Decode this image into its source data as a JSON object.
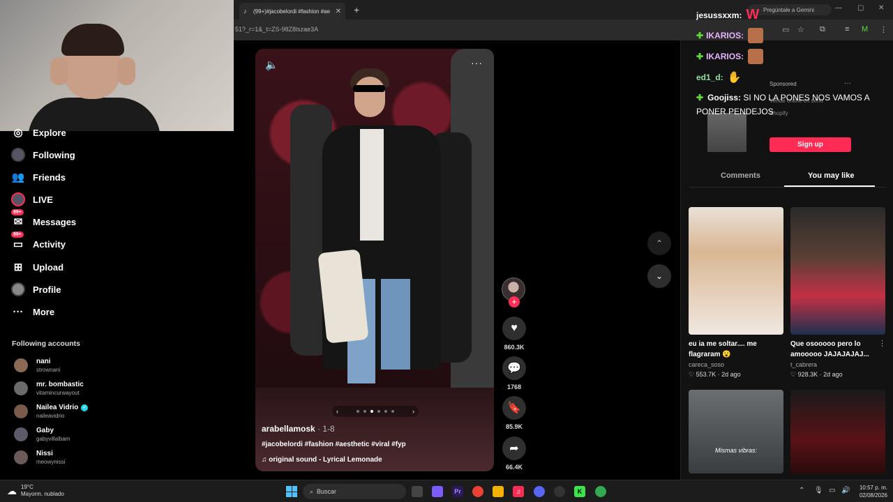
{
  "browser": {
    "tab_title": "(99+)#jacobelordi #fashion #ae",
    "url_fragment": "51?_r=1&_t=ZS-98Z8lszae3A",
    "gemini_label": "Pregúntale a Gemini"
  },
  "sidebar": {
    "nav": [
      {
        "label": "Explore",
        "icon": "explore-icon"
      },
      {
        "label": "Following",
        "icon": "following-icon"
      },
      {
        "label": "Friends",
        "icon": "friends-icon"
      },
      {
        "label": "LIVE",
        "icon": "live-icon"
      },
      {
        "label": "Messages",
        "icon": "messages-icon",
        "badge": "99+"
      },
      {
        "label": "Activity",
        "icon": "activity-icon",
        "badge": "99+"
      },
      {
        "label": "Upload",
        "icon": "upload-icon"
      },
      {
        "label": "Profile",
        "icon": "profile-icon"
      },
      {
        "label": "More",
        "icon": "more-icon"
      }
    ],
    "following_heading": "Following accounts",
    "accounts": [
      {
        "name": "nani",
        "user": "strownani",
        "color": "#8a6a55"
      },
      {
        "name": "mr. bombastic",
        "user": "vitamincurwayout",
        "color": "#6b6b6b"
      },
      {
        "name": "Nailea Vidrio",
        "user": "naileavidrio",
        "color": "#7a5a4a",
        "verified": true
      },
      {
        "name": "Gaby",
        "user": "gabyvillalbam",
        "color": "#5a5a6a"
      },
      {
        "name": "Nissi",
        "user": "meowynissi",
        "color": "#6a5a5a"
      }
    ]
  },
  "video": {
    "author": "arabellamosk",
    "date": " · 1-8",
    "tags": "#jacobelordi #fashion #aesthetic #viral #fyp",
    "sound": "original sound - Lyrical Lemonade",
    "carousel_current": 3,
    "carousel_total": 6
  },
  "actions": {
    "likes": "860.3K",
    "comments": "1768",
    "saves": "85.9K",
    "shares": "66.4K"
  },
  "ad": {
    "sponsored": "Sponsored",
    "title": "Vende online en serio",
    "brand": "Shopify",
    "cta": "Sign up"
  },
  "panel": {
    "tab_comments": "Comments",
    "tab_you_may_like": "You may like"
  },
  "cards": [
    {
      "title": "eu ia me soltar.... me flagraram 😮",
      "user": "careca_soso",
      "likes": "553.7K",
      "age": "2d ago"
    },
    {
      "title": "Que osooooo pero lo amooooo JAJAJAJAJ...",
      "user": "t_cabrera",
      "likes": "928.3K",
      "age": "2d ago"
    },
    {
      "overlay": "Mismas vibras:"
    },
    {}
  ],
  "chat": [
    {
      "user": "jesussxxm:",
      "badge": false
    },
    {
      "user": "IKARIOS:",
      "badge": true
    },
    {
      "user": "IKARIOS:",
      "badge": true
    },
    {
      "user": "ed1_d:",
      "badge": false
    },
    {
      "user": "Goojiss:",
      "badge": true,
      "message": "SI NO LA PONES NOS VAMOS A PONER PENDEJOS"
    }
  ],
  "taskbar": {
    "weather_temp": "19°C",
    "weather_desc": "Mayorm. nublado",
    "search_placeholder": "Buscar",
    "time": "10:57 p. m.",
    "date": "02/08/2026"
  },
  "colors": {
    "accent": "#fe2c55",
    "chat_badge": "#5fdc3a",
    "verified": "#20d5ec"
  }
}
